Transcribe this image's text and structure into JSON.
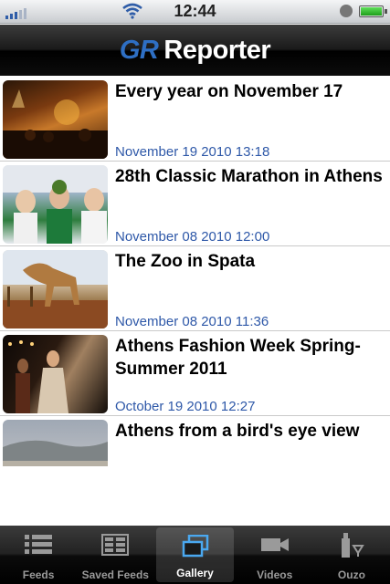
{
  "status_bar": {
    "time": "12:44"
  },
  "header": {
    "logo_prefix": "GR",
    "logo_text": "Reporter"
  },
  "articles": [
    {
      "title": "Every year on November 17",
      "date": "November 19 2010 13:18"
    },
    {
      "title": "28th Classic Marathon in Athens",
      "date": "November 08 2010 12:00"
    },
    {
      "title": "The Zoo in Spata",
      "date": "November 08 2010 11:36"
    },
    {
      "title": "Athens Fashion Week Spring-Summer 2011",
      "date": "October 19 2010 12:27"
    },
    {
      "title": "Athens from a bird's eye view",
      "date": ""
    }
  ],
  "tabs": [
    {
      "label": "Feeds",
      "icon": "list-icon",
      "active": false
    },
    {
      "label": "Saved Feeds",
      "icon": "saved-grid-icon",
      "active": false
    },
    {
      "label": "Gallery",
      "icon": "gallery-icon",
      "active": true
    },
    {
      "label": "Videos",
      "icon": "video-camera-icon",
      "active": false
    },
    {
      "label": "Ouzo",
      "icon": "ouzo-bottle-icon",
      "active": false
    }
  ],
  "colors": {
    "accent_blue": "#2e58a8",
    "logo_blue": "#2e6fc4",
    "navbar_black": "#000000"
  }
}
